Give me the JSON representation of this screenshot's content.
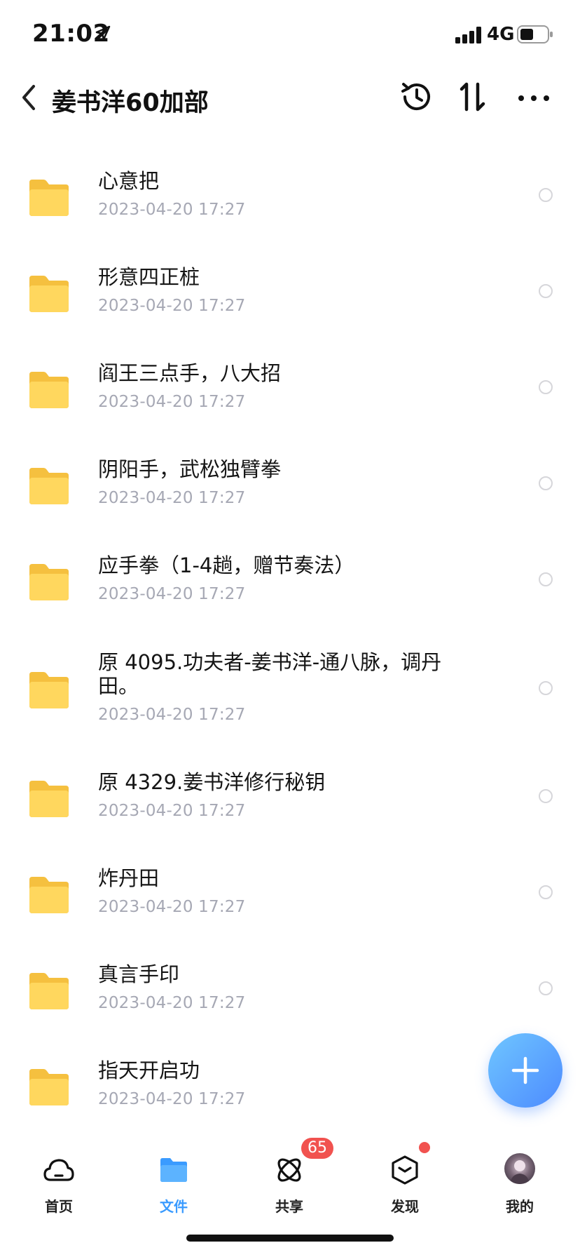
{
  "status_bar": {
    "time": "21:02",
    "network": "4G"
  },
  "nav": {
    "title": "姜书洋60加部"
  },
  "files": [
    {
      "name": "心意把",
      "date": "2023-04-20 17:27"
    },
    {
      "name": "形意四正桩",
      "date": "2023-04-20 17:27"
    },
    {
      "name": "阎王三点手，八大招",
      "date": "2023-04-20 17:27"
    },
    {
      "name": "阴阳手，武松独臂拳",
      "date": "2023-04-20 17:27"
    },
    {
      "name": "应手拳（1-4趟，赠节奏法）",
      "date": "2023-04-20 17:27"
    },
    {
      "name": "原 4095.功夫者-姜书洋-通八脉，调丹田。",
      "date": "2023-04-20 17:27"
    },
    {
      "name": "原 4329.姜书洋修行秘钥",
      "date": "2023-04-20 17:27"
    },
    {
      "name": "炸丹田",
      "date": "2023-04-20 17:27"
    },
    {
      "name": "真言手印",
      "date": "2023-04-20 17:27"
    },
    {
      "name": "指天开启功",
      "date": "2023-04-20 17:27"
    }
  ],
  "tabs": [
    {
      "label": "首页",
      "icon": "cloud-home-icon"
    },
    {
      "label": "文件",
      "icon": "folder-icon",
      "active": true
    },
    {
      "label": "共享",
      "icon": "share-orbit-icon",
      "badge": "65"
    },
    {
      "label": "发现",
      "icon": "discover-box-icon"
    },
    {
      "label": "我的",
      "icon": "avatar"
    }
  ],
  "colors": {
    "accent": "#3a9bff",
    "folder": "#ffd45c",
    "badge": "#f1524f",
    "date": "#a6a8b4"
  }
}
